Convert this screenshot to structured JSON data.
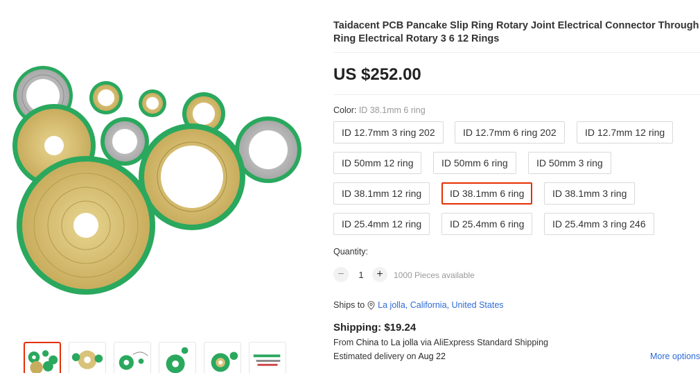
{
  "product": {
    "title_line1": "Taidacent PCB Pancake Slip Ring Rotary Joint Electrical Connector Through Bore S",
    "title_line2": "Ring Electrical Rotary 3 6 12 Rings",
    "price": "US $252.00"
  },
  "gallery": {
    "main_image": "slip-ring-pcb-product-photo",
    "thumbnails": [
      "thumb-1",
      "thumb-2",
      "thumb-3",
      "thumb-4",
      "thumb-5",
      "thumb-6"
    ],
    "active_index": 0
  },
  "color": {
    "label": "Color:",
    "selected": "ID 38.1mm 6 ring",
    "options": [
      "ID 12.7mm 3 ring 202",
      "ID 12.7mm 6 ring 202",
      "ID 12.7mm 12 ring",
      "ID 50mm 12 ring",
      "ID 50mm 6 ring",
      "ID 50mm 3 ring",
      "ID 38.1mm 12 ring",
      "ID 38.1mm 6 ring",
      "ID 38.1mm 3 ring",
      "ID 25.4mm 12 ring",
      "ID 25.4mm 6 ring",
      "ID 25.4mm 3 ring 246"
    ]
  },
  "quantity": {
    "label": "Quantity:",
    "minus": "−",
    "plus": "+",
    "value": "1",
    "available": "1000 Pieces available"
  },
  "shipping": {
    "ships_to_label": "Ships to",
    "location": "La jolla, California, United States",
    "cost": "Shipping: $19.24",
    "from_prefix": "From",
    "from_country": "China",
    "to_word": "to",
    "to_city": "La jolla",
    "via_text": "via AliExpress Standard Shipping",
    "delivery_prefix": "Estimated delivery on",
    "delivery_date": "Aug 22",
    "more_options": "More options"
  },
  "colors": {
    "accent_red": "#e62e04",
    "link_blue": "#2e6bd6",
    "pcb_green": "#1fae5a",
    "copper_gold": "#d9c27a"
  }
}
